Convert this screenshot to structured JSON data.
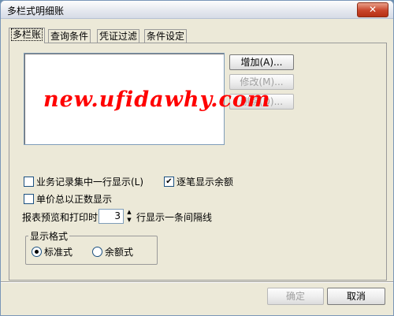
{
  "window": {
    "title": "多栏式明细账",
    "close_glyph": "✕"
  },
  "tabs": [
    {
      "label": "多栏账",
      "active": true
    },
    {
      "label": "查询条件",
      "active": false
    },
    {
      "label": "凭证过滤",
      "active": false
    },
    {
      "label": "条件设定",
      "active": false
    }
  ],
  "list_buttons": {
    "add": "增加(A)...",
    "modify": "修改(M)...",
    "delete": "删除(D)..."
  },
  "watermark": "new.ufidawhy.com",
  "options": {
    "single_line": {
      "label": "业务记录集中一行显示(L)",
      "checked": false
    },
    "show_balance": {
      "label": "逐笔显示余额",
      "checked": true
    },
    "positive_price": {
      "label": "单价总以正数显示",
      "checked": false
    }
  },
  "separator_line": {
    "prefix": "报表预览和打印时",
    "value": "3",
    "suffix": "行显示一条间隔线"
  },
  "display_format": {
    "title": "显示格式",
    "standard": {
      "label": "标准式",
      "selected": true
    },
    "balance": {
      "label": "余额式",
      "selected": false
    }
  },
  "footer": {
    "ok": "确定",
    "cancel": "取消"
  },
  "icons": {
    "check": "✔",
    "spin_up": "▲",
    "spin_down": "▼"
  }
}
